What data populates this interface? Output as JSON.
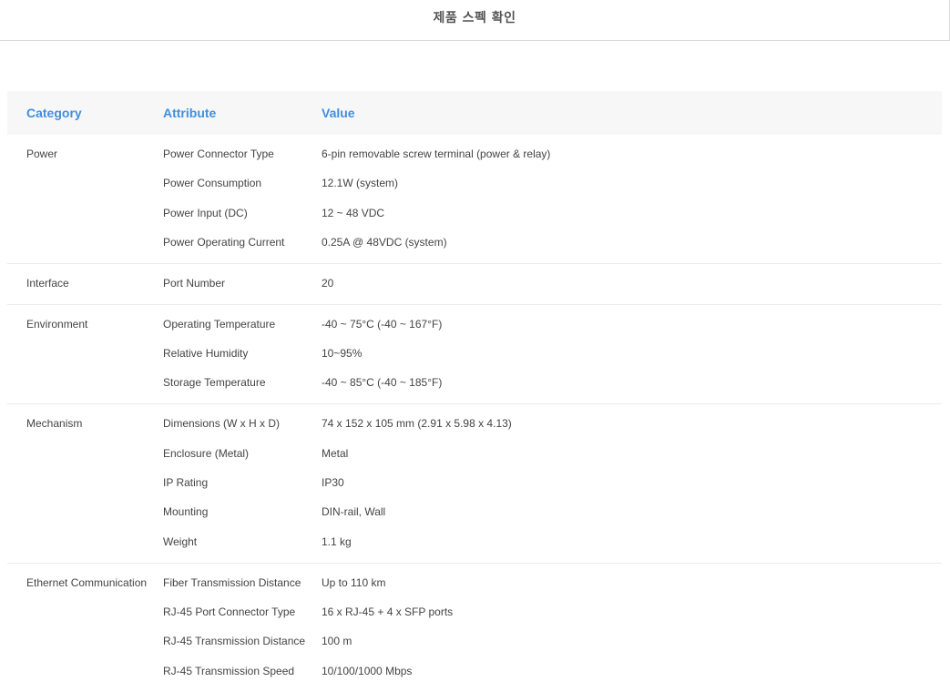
{
  "header": {
    "title": "제품 스펙 확인"
  },
  "table": {
    "columns": [
      "Category",
      "Attribute",
      "Value"
    ],
    "groups": [
      {
        "category": "Power",
        "rows": [
          {
            "attribute": "Power Connector Type",
            "value": "6-pin removable screw terminal (power & relay)"
          },
          {
            "attribute": "Power Consumption",
            "value": "12.1W (system)"
          },
          {
            "attribute": "Power Input (DC)",
            "value": "12 ~ 48 VDC"
          },
          {
            "attribute": "Power Operating Current",
            "value": "0.25A @ 48VDC (system)"
          }
        ]
      },
      {
        "category": "Interface",
        "rows": [
          {
            "attribute": "Port Number",
            "value": "20"
          }
        ]
      },
      {
        "category": "Environment",
        "rows": [
          {
            "attribute": "Operating Temperature",
            "value": "-40 ~ 75°C (-40 ~ 167°F)"
          },
          {
            "attribute": "Relative Humidity",
            "value": "10~95%"
          },
          {
            "attribute": "Storage Temperature",
            "value": "-40 ~ 85°C (-40 ~ 185°F)"
          }
        ]
      },
      {
        "category": "Mechanism",
        "rows": [
          {
            "attribute": "Dimensions (W x H x D)",
            "value": "74 x 152 x 105 mm (2.91 x 5.98 x 4.13)"
          },
          {
            "attribute": "Enclosure (Metal)",
            "value": "Metal"
          },
          {
            "attribute": "IP Rating",
            "value": "IP30"
          },
          {
            "attribute": "Mounting",
            "value": "DIN-rail, Wall"
          },
          {
            "attribute": "Weight",
            "value": "1.1 kg"
          }
        ]
      },
      {
        "category": "Ethernet Communication",
        "rows": [
          {
            "attribute": "Fiber Transmission Distance",
            "value": "Up to 110 km"
          },
          {
            "attribute": "RJ-45 Port Connector Type",
            "value": "16 x RJ-45 + 4 x SFP ports"
          },
          {
            "attribute": "RJ-45 Transmission Distance",
            "value": "100 m"
          },
          {
            "attribute": "RJ-45 Transmission Speed",
            "value": "10/100/1000 Mbps"
          }
        ]
      }
    ]
  }
}
